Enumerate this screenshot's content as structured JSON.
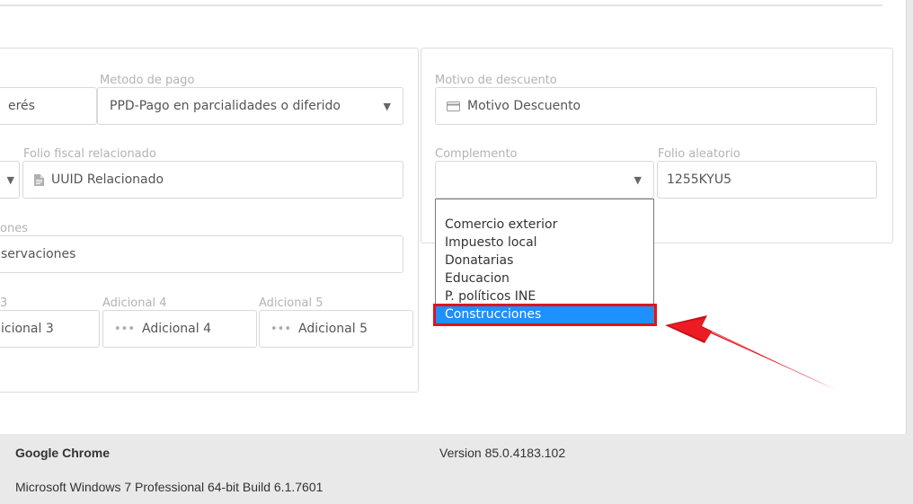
{
  "left_panel": {
    "metodo_pago": {
      "label": "Metodo de pago",
      "value": "PPD-Pago en parcialidades o diferido"
    },
    "partial_field_value": "erés",
    "folio_fiscal": {
      "label": "Folio fiscal relacionado",
      "placeholder": "UUID Relacionado"
    },
    "observaciones": {
      "label_partial": "ones",
      "value_partial": "servaciones"
    },
    "adicional_3": {
      "label_partial": "3",
      "placeholder_partial": "icional 3"
    },
    "adicional_4": {
      "label": "Adicional 4",
      "placeholder": "Adicional 4"
    },
    "adicional_5": {
      "label": "Adicional 5",
      "placeholder": "Adicional 5"
    }
  },
  "right_panel": {
    "motivo_descuento": {
      "label": "Motivo de descuento",
      "placeholder": "Motivo Descuento"
    },
    "complemento": {
      "label": "Complemento",
      "value": "",
      "options": [
        "",
        "Comercio exterior",
        "Impuesto local",
        "Donatarias",
        "Educacion",
        "P. políticos INE",
        "Construcciones"
      ],
      "highlighted_option": "Construcciones"
    },
    "folio_aleatorio": {
      "label": "Folio aleatorio",
      "value": "1255KYU5"
    }
  },
  "annotation": {
    "arrow_color": "#e0141c",
    "box_color": "#e0141c"
  },
  "footer": {
    "app_name": "Google Chrome",
    "version": "Version 85.0.4183.102",
    "os": "Microsoft Windows 7 Professional  64-bit Build 6.1.7601"
  }
}
